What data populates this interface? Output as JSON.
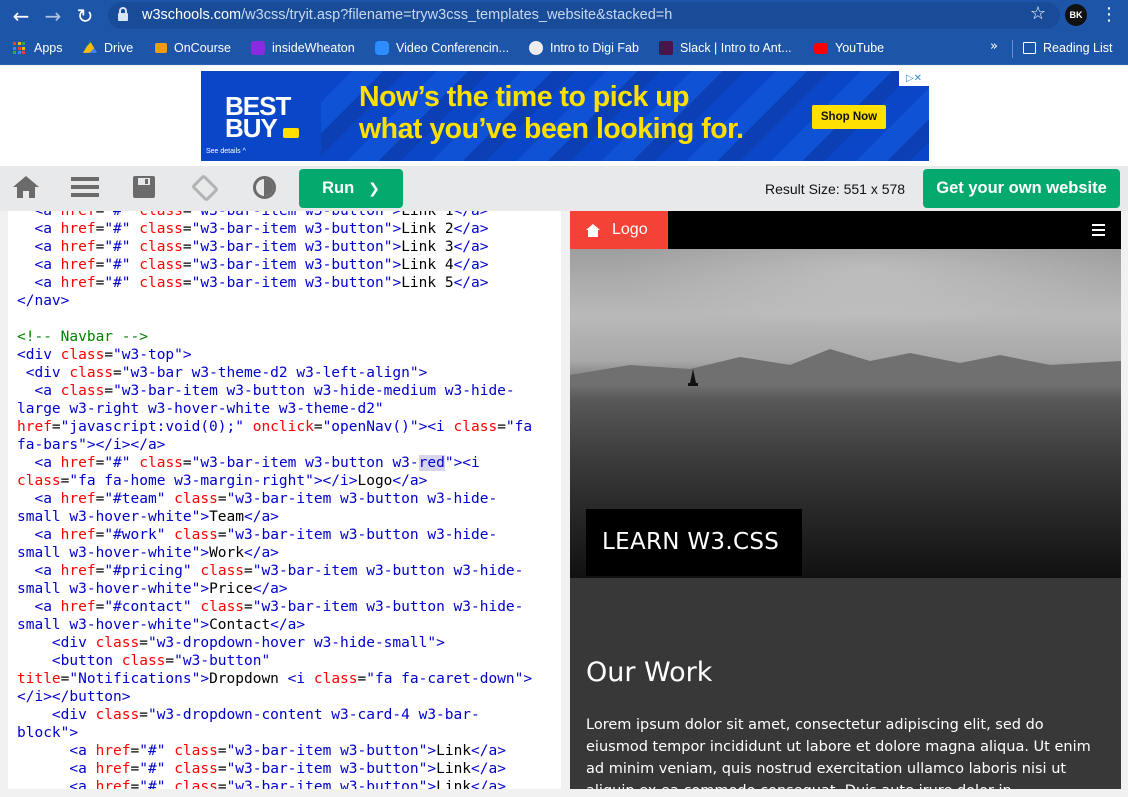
{
  "browser": {
    "url_host": "w3schools.com",
    "url_path": "/w3css/tryit.asp?filename=tryw3css_templates_website&stacked=h",
    "avatar": "BK",
    "bookmarks": [
      {
        "label": "Apps",
        "icon": "apps-grid-icon"
      },
      {
        "label": "Drive",
        "icon": "drive-icon"
      },
      {
        "label": "OnCourse",
        "icon": "oncourse-icon"
      },
      {
        "label": "insideWheaton",
        "icon": "insidewheaton-icon"
      },
      {
        "label": "Video Conferencin...",
        "icon": "zoom-icon"
      },
      {
        "label": "Intro to Digi Fab",
        "icon": "globe-icon"
      },
      {
        "label": "Slack | Intro to Ant...",
        "icon": "slack-icon"
      },
      {
        "label": "YouTube",
        "icon": "youtube-icon"
      }
    ],
    "more": "»",
    "reading_list": "Reading List"
  },
  "ad": {
    "brand_line1": "BEST",
    "brand_line2": "BUY",
    "details": "See details ^",
    "headline_line1": "Now’s the time to pick up",
    "headline_line2": "what you’ve been looking for.",
    "cta": "Shop Now",
    "colors": {
      "background": "#0a46c8",
      "accent": "#ffe000"
    }
  },
  "toolbar": {
    "run_label": "Run",
    "run_chevron": "❯",
    "result_size": "Result Size: 551 x 578",
    "own_website": "Get your own website",
    "accent": "#04aa6d"
  },
  "result": {
    "logo_label": "Logo",
    "hero_caption": "LEARN W3.CSS",
    "section_title": "Our Work",
    "paragraph": "Lorem ipsum dolor sit amet, consectetur adipiscing elit, sed do eiusmod tempor incididunt ut labore et dolore magna aliqua. Ut enim ad minim veniam, quis nostrud exercitation ullamco laboris nisi ut aliquip ex ea commodo consequat. Duis aute irure dolor in",
    "colors": {
      "navbar": "#000000",
      "logo": "#f44336",
      "body": "#383838"
    }
  }
}
